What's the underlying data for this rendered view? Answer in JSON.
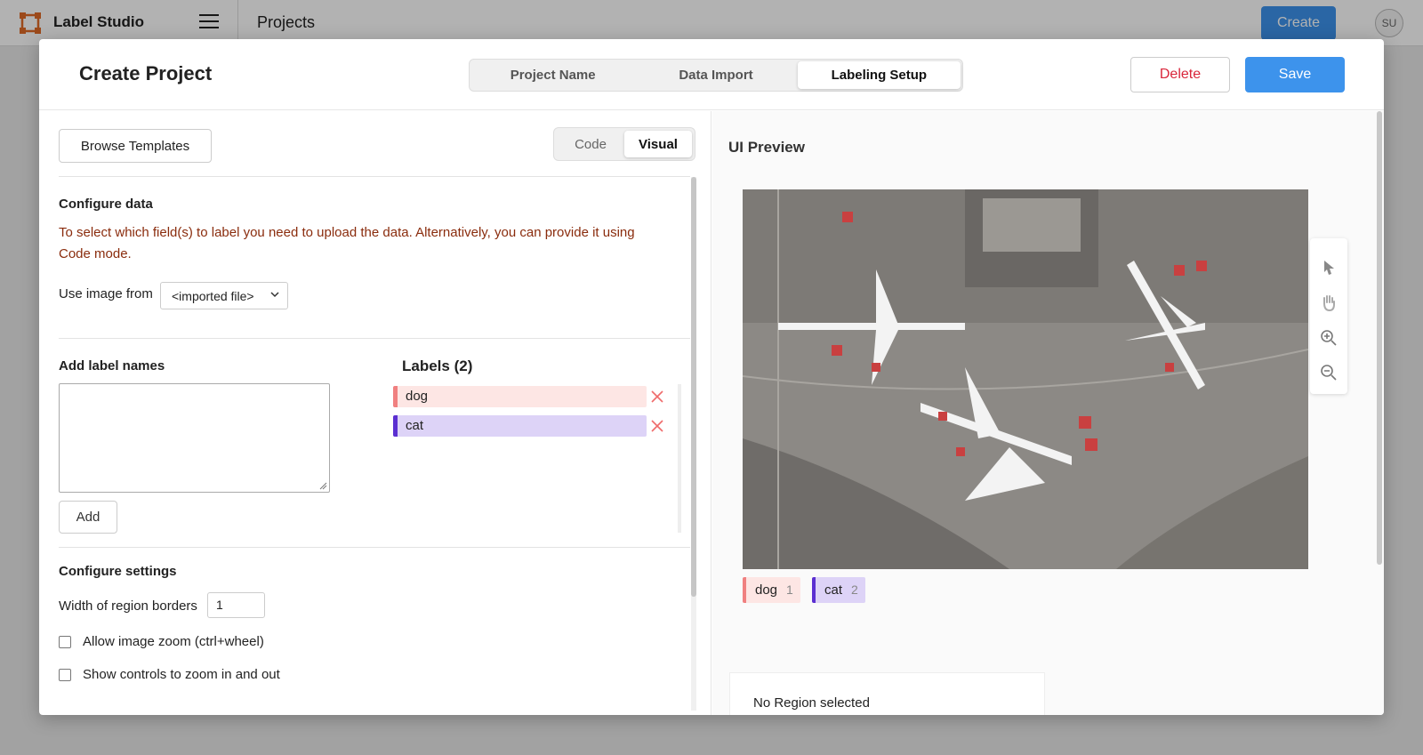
{
  "app": {
    "name": "Label Studio",
    "breadcrumb": "Projects",
    "create_label": "Create",
    "avatar_initials": "SU"
  },
  "modal": {
    "title": "Create Project",
    "steps": [
      {
        "label": "Project Name"
      },
      {
        "label": "Data Import"
      },
      {
        "label": "Labeling Setup",
        "active": true
      }
    ],
    "delete_label": "Delete",
    "save_label": "Save"
  },
  "config": {
    "browse_label": "Browse Templates",
    "modes": {
      "code": "Code",
      "visual": "Visual",
      "active": "Visual"
    },
    "configure_data": {
      "title": "Configure data",
      "warning": "To select which field(s) to label you need to upload the data. Alternatively, you can provide it using Code mode.",
      "use_image_label": "Use image from",
      "use_image_value": "<imported file>"
    },
    "add_labels": {
      "title": "Add label names",
      "textarea_value": "",
      "add_label": "Add",
      "labels_title": "Labels (2)",
      "labels": [
        {
          "name": "dog",
          "color": "#f08080",
          "bg": "#fde6e4"
        },
        {
          "name": "cat",
          "color": "#5b2fd1",
          "bg": "#ddd3f7"
        }
      ]
    },
    "settings": {
      "title": "Configure settings",
      "border_width_label": "Width of region borders",
      "border_width_value": "1",
      "zoom_label": "Allow image zoom (ctrl+wheel)",
      "zoom_checked": false,
      "controls_label": "Show controls to zoom in and out",
      "controls_checked": false
    }
  },
  "preview": {
    "title": "UI Preview",
    "legend": [
      {
        "name": "dog",
        "count": "1",
        "color": "#f08080",
        "bg": "#fde6e4"
      },
      {
        "name": "cat",
        "count": "2",
        "color": "#5b2fd1",
        "bg": "#ddd3f7"
      }
    ],
    "tools": [
      "pointer-icon",
      "hand-icon",
      "zoom-in-icon",
      "zoom-out-icon"
    ],
    "region_status": "No Region selected"
  }
}
